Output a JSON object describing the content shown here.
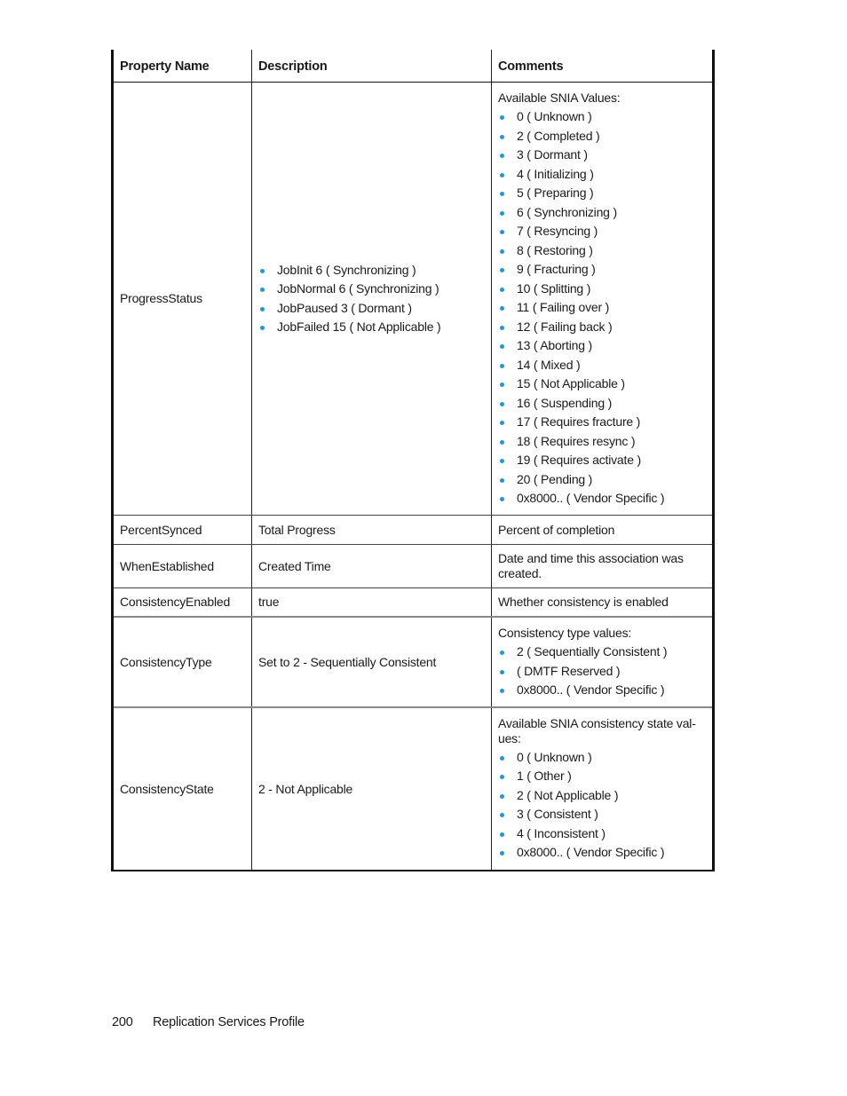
{
  "table": {
    "headers": [
      "Property Name",
      "Description",
      "Comments"
    ],
    "rows": {
      "progress_status": {
        "property": "ProgressStatus",
        "description_items": [
          "JobInit 6 ( Synchronizing )",
          "JobNormal 6 ( Synchronizing )",
          "JobPaused 3 ( Dormant )",
          "JobFailed 15 ( Not Applicable )"
        ],
        "comments_intro": "Available SNIA Values:",
        "comments_items": [
          "0 ( Unknown )",
          "2 ( Completed )",
          "3 ( Dormant )",
          "4 ( Initializing )",
          "5 ( Preparing )",
          "6 ( Synchronizing )",
          "7 ( Resyncing )",
          "8 ( Restoring )",
          "9 ( Fracturing )",
          "10 ( Splitting )",
          "11 ( Failing over )",
          "12 ( Failing back )",
          "13 ( Aborting )",
          "14 ( Mixed )",
          "15 ( Not Applicable )",
          "16 ( Suspending )",
          "17 ( Requires fracture )",
          "18 ( Requires resync )",
          "19 ( Requires activate )",
          "20 ( Pending )",
          "0x8000.. ( Vendor Specific )"
        ]
      },
      "percent_synced": {
        "property": "PercentSynced",
        "description": "Total Progress",
        "comments": "Percent of completion"
      },
      "when_established": {
        "property": "WhenEstablished",
        "description": "Created Time",
        "comments": "Date and time this association was created."
      },
      "consistency_enabled": {
        "property": "ConsistencyEnabled",
        "description": "true",
        "comments": "Whether consistency is enabled"
      },
      "consistency_type": {
        "property": "ConsistencyType",
        "description": "Set to 2 - Sequentially Consistent",
        "comments_intro": "Consistency type values:",
        "comments_items": [
          "2 ( Sequentially Consistent )",
          "( DMTF Reserved )",
          "0x8000.. ( Vendor Specific )"
        ]
      },
      "consistency_state": {
        "property": "ConsistencyState",
        "description": "2 - Not Applicable",
        "comments_intro": "Available SNIA consistency state val-ues:",
        "comments_items": [
          "0 ( Unknown )",
          "1 ( Other )",
          "2 ( Not Applicable )",
          "3 ( Consistent )",
          "4 ( Inconsistent )",
          "0x8000.. ( Vendor Specific )"
        ]
      }
    }
  },
  "colors": {
    "bullet": "#1a9ad6"
  },
  "footer": {
    "page_number": "200",
    "section_title": "Replication Services Profile"
  }
}
